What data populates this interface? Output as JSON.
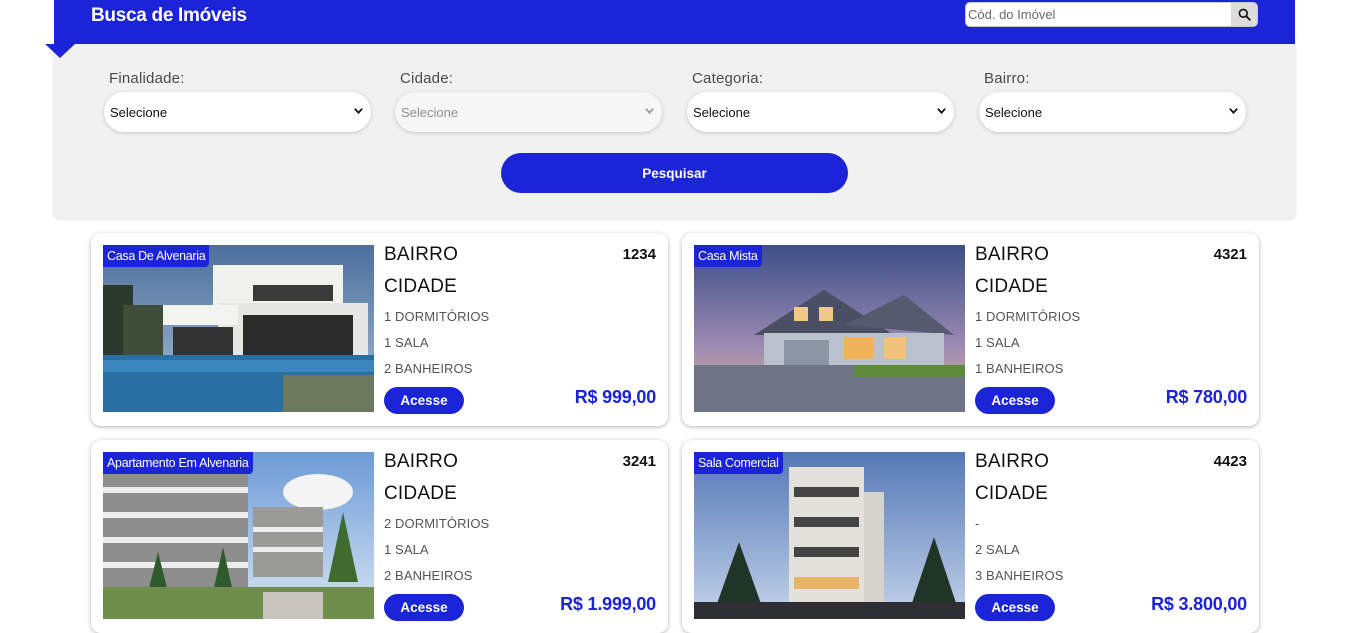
{
  "header": {
    "title": "Busca de Imóveis",
    "code_placeholder": "Cód. do Imóvel",
    "search_icon": "search-icon"
  },
  "filters": {
    "finalidade": {
      "label": "Finalidade:",
      "value": "Selecione"
    },
    "cidade": {
      "label": "Cidade:",
      "value": "Selecione"
    },
    "categoria": {
      "label": "Categoria:",
      "value": "Selecione"
    },
    "bairro": {
      "label": "Bairro:",
      "value": "Selecione"
    },
    "submit_label": "Pesquisar"
  },
  "colors": {
    "brand": "#1b24d6",
    "panel": "#f1f1f1",
    "price": "#1b24d6"
  },
  "listings": [
    {
      "badge": "Casa De Alvenaria",
      "bairro": "BAIRRO",
      "cidade": "CIDADE",
      "code": "1234",
      "dorms": "1 DORMITÓRIOS",
      "salas": "1 SALA",
      "banheiros": "2 BANHEIROS",
      "button": "Acesse",
      "price": "R$ 999,00"
    },
    {
      "badge": "Casa Mista",
      "bairro": "BAIRRO",
      "cidade": "CIDADE",
      "code": "4321",
      "dorms": "1 DORMITÓRIOS",
      "salas": "1 SALA",
      "banheiros": "1 BANHEIROS",
      "button": "Acesse",
      "price": "R$ 780,00"
    },
    {
      "badge": "Apartamento Em Alvenaria",
      "bairro": "BAIRRO",
      "cidade": "CIDADE",
      "code": "3241",
      "dorms": "2 DORMITÓRIOS",
      "salas": "1 SALA",
      "banheiros": "2 BANHEIROS",
      "button": "Acesse",
      "price": "R$ 1.999,00"
    },
    {
      "badge": "Sala Comercial",
      "bairro": "BAIRRO",
      "cidade": "CIDADE",
      "code": "4423",
      "dorms": "-",
      "salas": "2 SALA",
      "banheiros": "3 BANHEIROS",
      "button": "Acesse",
      "price": "R$ 3.800,00"
    }
  ]
}
